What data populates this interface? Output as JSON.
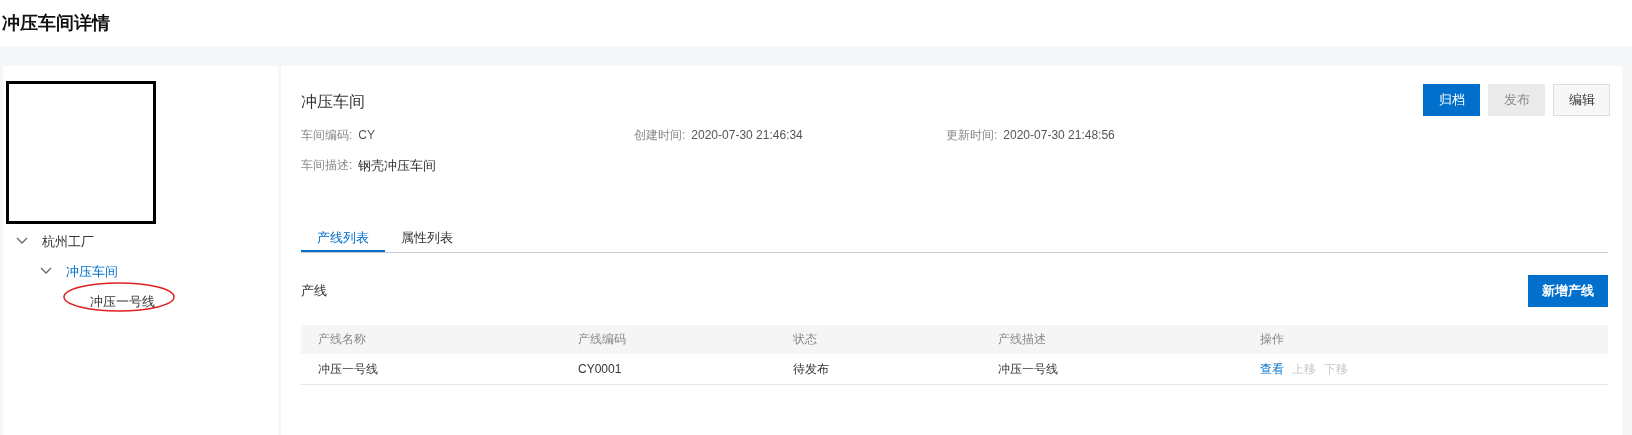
{
  "page_title": "冲压车间详情",
  "tree": [
    {
      "label": "杭州工厂",
      "expanded": true,
      "selected": false,
      "children": [
        {
          "label": "冲压车间",
          "expanded": true,
          "selected": true,
          "children": [
            {
              "label": "冲压一号线",
              "selected": false,
              "highlighted": true
            }
          ]
        }
      ]
    }
  ],
  "detail": {
    "title": "冲压车间",
    "fields": [
      {
        "label": "车间编码:",
        "value": "CY"
      },
      {
        "label": "创建时间:",
        "value": "2020-07-30 21:46:34"
      },
      {
        "label": "更新时间:",
        "value": "2020-07-30 21:48:56"
      },
      {
        "label": "车间描述:",
        "value": "钢壳冲压车间"
      }
    ],
    "buttons": [
      {
        "label": "归档",
        "kind": "primary",
        "disabled": false
      },
      {
        "label": "发布",
        "kind": "default",
        "disabled": true
      },
      {
        "label": "编辑",
        "kind": "default",
        "disabled": false
      }
    ]
  },
  "tabs": [
    {
      "label": "产线列表",
      "selected": true
    },
    {
      "label": "属性列表",
      "selected": false
    }
  ],
  "section": {
    "title": "产线",
    "add_button": "新增产线"
  },
  "table": {
    "columns": [
      "产线名称",
      "产线编码",
      "状态",
      "产线描述",
      "操作"
    ],
    "rows": [
      {
        "cells": [
          "冲压一号线",
          "CY0001",
          "待发布",
          "冲压一号线"
        ],
        "actions": [
          {
            "label": "查看",
            "disabled": false
          },
          {
            "label": "上移",
            "disabled": true
          },
          {
            "label": "下移",
            "disabled": true
          }
        ]
      }
    ]
  }
}
